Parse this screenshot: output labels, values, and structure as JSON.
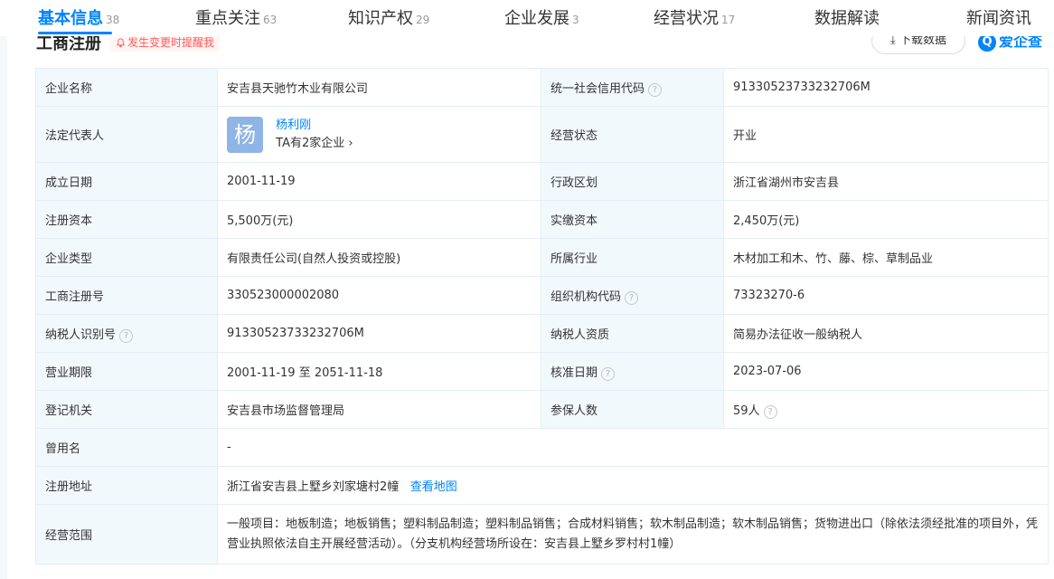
{
  "tabs": [
    {
      "label": "基本信息",
      "count": "38"
    },
    {
      "label": "重点关注",
      "count": "63"
    },
    {
      "label": "知识产权",
      "count": "29"
    },
    {
      "label": "企业发展",
      "count": "3"
    },
    {
      "label": "经营状况",
      "count": "17"
    },
    {
      "label": "数据解读",
      "count": ""
    },
    {
      "label": "新闻资讯",
      "count": ""
    }
  ],
  "section": {
    "title": "工商注册",
    "notify_label": "发生变更时提醒我",
    "download_label": "下载数据",
    "brand": "爱企查",
    "brand_mark": "Q"
  },
  "company": {
    "name_label": "企业名称",
    "name": "安吉县天驰竹木业有限公司",
    "credit_label": "统一社会信用代码",
    "credit": "91330523733232706M",
    "legal_label": "法定代表人",
    "legal_avatar": "杨",
    "legal_name": "杨利刚",
    "legal_sub": "TA有2家企业",
    "status_label": "经营状态",
    "status": "开业",
    "founded_label": "成立日期",
    "founded": "2001-11-19",
    "region_label": "行政区划",
    "region": "浙江省湖州市安吉县",
    "capital_label": "注册资本",
    "capital": "5,500万(元)",
    "paid_label": "实缴资本",
    "paid": "2,450万(元)",
    "type_label": "企业类型",
    "type": "有限责任公司(自然人投资或控股)",
    "industry_label": "所属行业",
    "industry": "木材加工和木、竹、藤、棕、草制品业",
    "regno_label": "工商注册号",
    "regno": "330523000002080",
    "orgcode_label": "组织机构代码",
    "orgcode": "73323270-6",
    "taxid_label": "纳税人识别号",
    "taxid": "91330523733232706M",
    "taxqual_label": "纳税人资质",
    "taxqual": "简易办法征收一般纳税人",
    "term_label": "营业期限",
    "term": "2001-11-19 至 2051-11-18",
    "approve_label": "核准日期",
    "approve": "2023-07-06",
    "authority_label": "登记机关",
    "authority": "安吉县市场监督管理局",
    "insured_label": "参保人数",
    "insured": "59人",
    "former_label": "曾用名",
    "former": "-",
    "address_label": "注册地址",
    "address": "浙江省安吉县上墅乡刘家塘村2幢",
    "map_link": "查看地图",
    "scope_label": "经营范围",
    "scope": "一般项目：地板制造；地板销售；塑料制品制造；塑料制品销售；合成材料销售；软木制品制造；软木制品销售；货物进出口（除依法须经批准的项目外，凭营业执照依法自主开展经营活动）。（分支机构经营场所设在：安吉县上墅乡罗村村1幢）"
  },
  "colors": {
    "accent": "#0084ff",
    "label_bg": "#f2f9fc",
    "border": "#e4eef6",
    "notify": "#ff5a5a"
  },
  "icons": [
    "help-icon",
    "bell-icon",
    "download-icon",
    "chevron-right-icon"
  ]
}
